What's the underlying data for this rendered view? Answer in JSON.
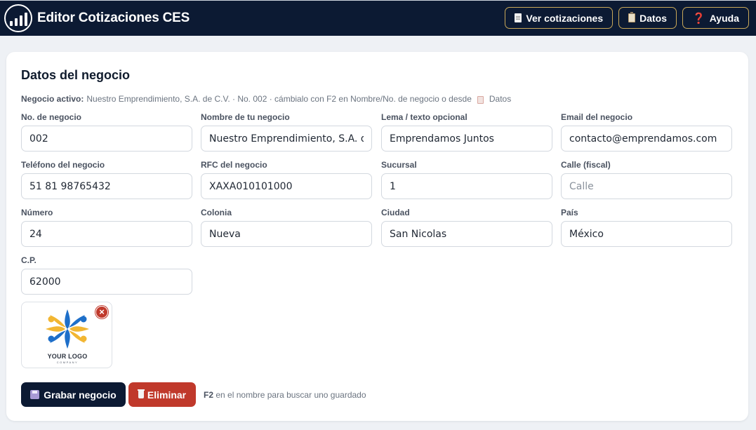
{
  "app": {
    "title": "Editor Cotizaciones CES",
    "colors": {
      "navy": "#0c1a33",
      "accent_border": "#c9a858",
      "danger": "#c0392b"
    }
  },
  "toolbar": {
    "ver_cotizaciones": {
      "label": "Ver cotizaciones",
      "icon": "document-icon"
    },
    "datos": {
      "label": "Datos",
      "icon": "clipboard-icon"
    },
    "ayuda": {
      "label": "Ayuda",
      "icon": "question-icon",
      "glyph": "❓"
    }
  },
  "section": {
    "title": "Datos del negocio",
    "active_label": "Negocio activo:",
    "active_value": "Nuestro Emprendimiento, S.A. de C.V. · No. 002 · cámbialo con F2 en Nombre/No. de negocio o desde",
    "active_link": "Datos"
  },
  "fields": {
    "numero_negocio": {
      "label": "No. de negocio",
      "value": "002",
      "placeholder": ""
    },
    "nombre": {
      "label": "Nombre de tu negocio",
      "value": "Nuestro Emprendimiento, S.A. de C.V.",
      "placeholder": ""
    },
    "lema": {
      "label": "Lema / texto opcional",
      "value": "Emprendamos Juntos",
      "placeholder": ""
    },
    "email": {
      "label": "Email del negocio",
      "value": "contacto@emprendamos.com",
      "placeholder": ""
    },
    "telefono": {
      "label": "Teléfono del negocio",
      "value": "51 81 98765432",
      "placeholder": ""
    },
    "rfc": {
      "label": "RFC del negocio",
      "value": "XAXA010101000",
      "placeholder": ""
    },
    "sucursal": {
      "label": "Sucursal",
      "value": "1",
      "placeholder": ""
    },
    "calle": {
      "label": "Calle (fiscal)",
      "value": "",
      "placeholder": "Calle"
    },
    "numero": {
      "label": "Número",
      "value": "24",
      "placeholder": ""
    },
    "colonia": {
      "label": "Colonia",
      "value": "Nueva",
      "placeholder": ""
    },
    "ciudad": {
      "label": "Ciudad",
      "value": "San Nicolas",
      "placeholder": ""
    },
    "pais": {
      "label": "País",
      "value": "México",
      "placeholder": ""
    },
    "cp": {
      "label": "C.P.",
      "value": "62000",
      "placeholder": ""
    }
  },
  "logo": {
    "text": "YOUR LOGO",
    "subtext": "COMPANY",
    "remove_glyph": "×"
  },
  "actions": {
    "save_label": "Grabar negocio",
    "delete_label": "Eliminar",
    "hint_key": "F2",
    "hint_text": "en el nombre para buscar uno guardado"
  }
}
